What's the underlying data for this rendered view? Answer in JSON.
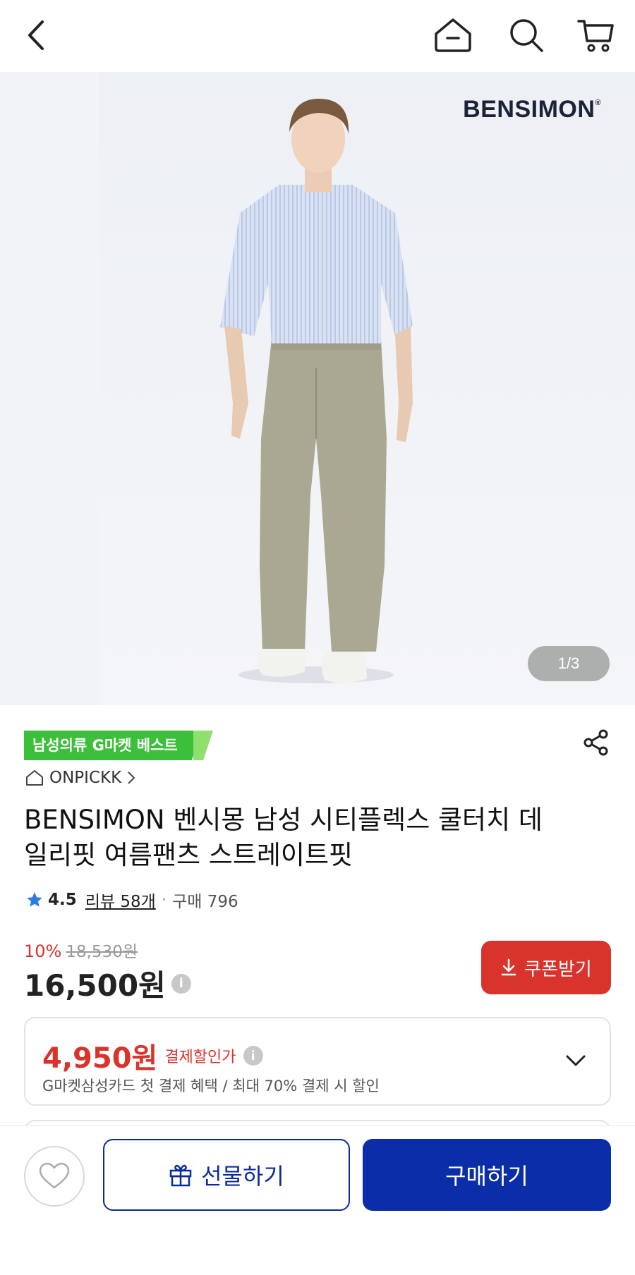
{
  "header": {
    "back_icon": "chevron-left-icon",
    "home_icon": "home-icon",
    "search_icon": "search-icon",
    "cart_icon": "cart-icon"
  },
  "hero": {
    "brand_logo": "BENSIMON",
    "image_counter": "1/3"
  },
  "product": {
    "badge": "남성의류 G마켓 베스트",
    "shop_name": "ONPICKK",
    "title": "BENSIMON 벤시몽 남성 시티플렉스 쿨터치 데일리핏 여름팬츠 스트레이트핏",
    "rating": "4.5",
    "reviews_label": "리뷰 58개",
    "separator": "·",
    "purchases_label": "구매 796",
    "discount_percent": "10%",
    "original_price": "18,530원",
    "price": "16,500원",
    "coupon_button": "쿠폰받기"
  },
  "card_offer": {
    "amount": "4,950원",
    "label": "결제할인가",
    "description": "G마켓삼성카드 첫 결제 혜택 / 최대 70% 결제 시 할인"
  },
  "bottom_bar": {
    "gift_button": "선물하기",
    "buy_button": "구매하기"
  },
  "colors": {
    "accent_red": "#d8342b",
    "primary_blue": "#0a2ea8",
    "badge_green": "#3cbf3a"
  }
}
